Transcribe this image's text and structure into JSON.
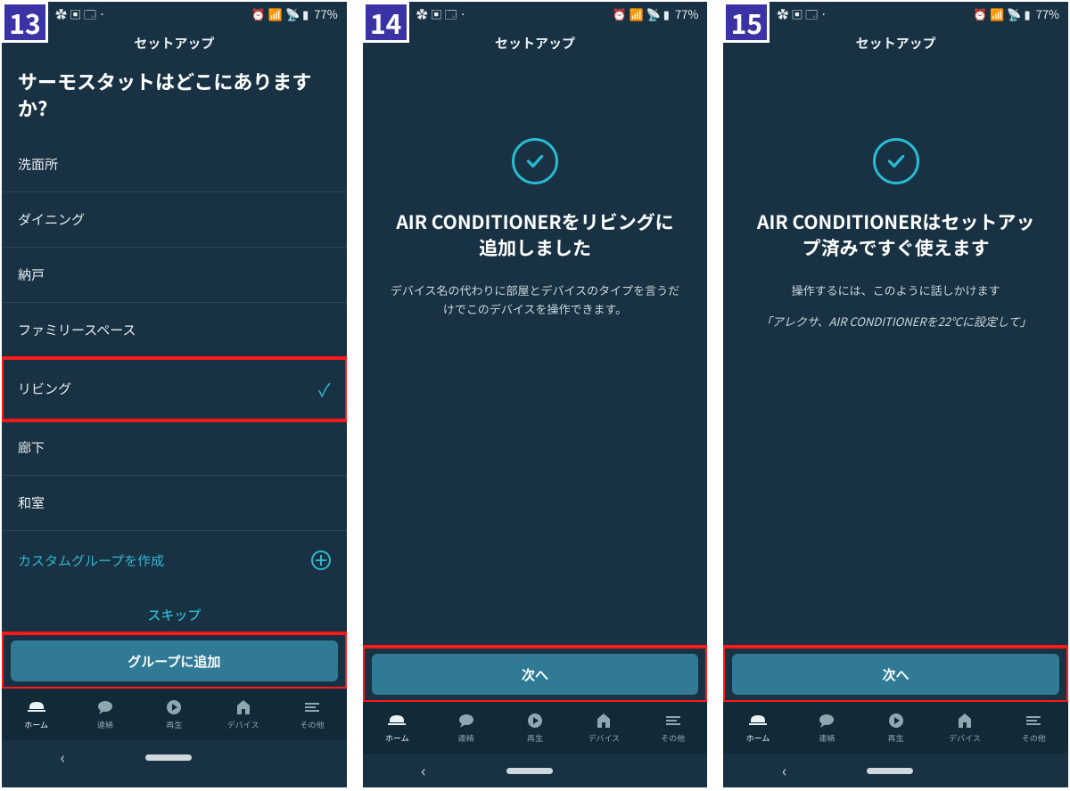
{
  "status": {
    "left_icons": "✿ ▣ 🗔 ·",
    "right_icons": "⏰ 📶 📡 ▮",
    "battery": "77%"
  },
  "common": {
    "header": "セットアップ",
    "tabs": {
      "home": "ホーム",
      "contact": "連絡",
      "play": "再生",
      "device": "デバイス",
      "more": "その他"
    }
  },
  "screen13": {
    "step": "13",
    "question": "サーモスタットはどこにありますか?",
    "rooms": [
      "洗面所",
      "ダイニング",
      "納戸",
      "ファミリースペース",
      "リビング",
      "廊下",
      "和室"
    ],
    "selected_room": "リビング",
    "custom_group": "カスタムグループを作成",
    "skip": "スキップ",
    "primary_button": "グループに追加"
  },
  "screen14": {
    "step": "14",
    "title": "AIR CONDITIONERをリビングに追加しました",
    "desc": "デバイス名の代わりに部屋とデバイスのタイプを言うだけでこのデバイスを操作できます。",
    "primary_button": "次へ"
  },
  "screen15": {
    "step": "15",
    "title": "AIR CONDITIONERはセットアップ済みですぐ使えます",
    "desc": "操作するには、このように話しかけます",
    "quote": "「アレクサ、AIR CONDITIONERを22℃に設定して」",
    "primary_button": "次へ"
  }
}
